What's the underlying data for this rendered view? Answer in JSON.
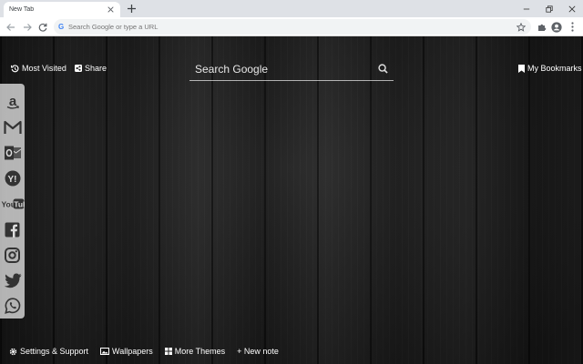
{
  "browser": {
    "tab_title": "New Tab",
    "omnibox_placeholder": "Search Google or type a URL",
    "omnibox_g": "G"
  },
  "header": {
    "most_visited": "Most Visited",
    "share": "Share",
    "bookmarks": "My Bookmarks"
  },
  "search": {
    "placeholder": "Search Google"
  },
  "sidebar": {
    "items": [
      {
        "icon": "amazon-icon"
      },
      {
        "icon": "gmail-icon"
      },
      {
        "icon": "outlook-icon"
      },
      {
        "icon": "yahoo-icon"
      },
      {
        "icon": "youtube-icon",
        "text": "You Tube"
      },
      {
        "icon": "facebook-icon"
      },
      {
        "icon": "instagram-icon"
      },
      {
        "icon": "twitter-icon"
      },
      {
        "icon": "whatsapp-icon"
      }
    ]
  },
  "footer": {
    "settings": "Settings & Support",
    "wallpapers": "Wallpapers",
    "more_themes": "More Themes",
    "new_note": "+ New note"
  },
  "colors": {
    "background": "#1f1f1f",
    "sidebar_bg": "#e1e1e1",
    "text": "#ffffff",
    "icon_dark": "#333333"
  }
}
